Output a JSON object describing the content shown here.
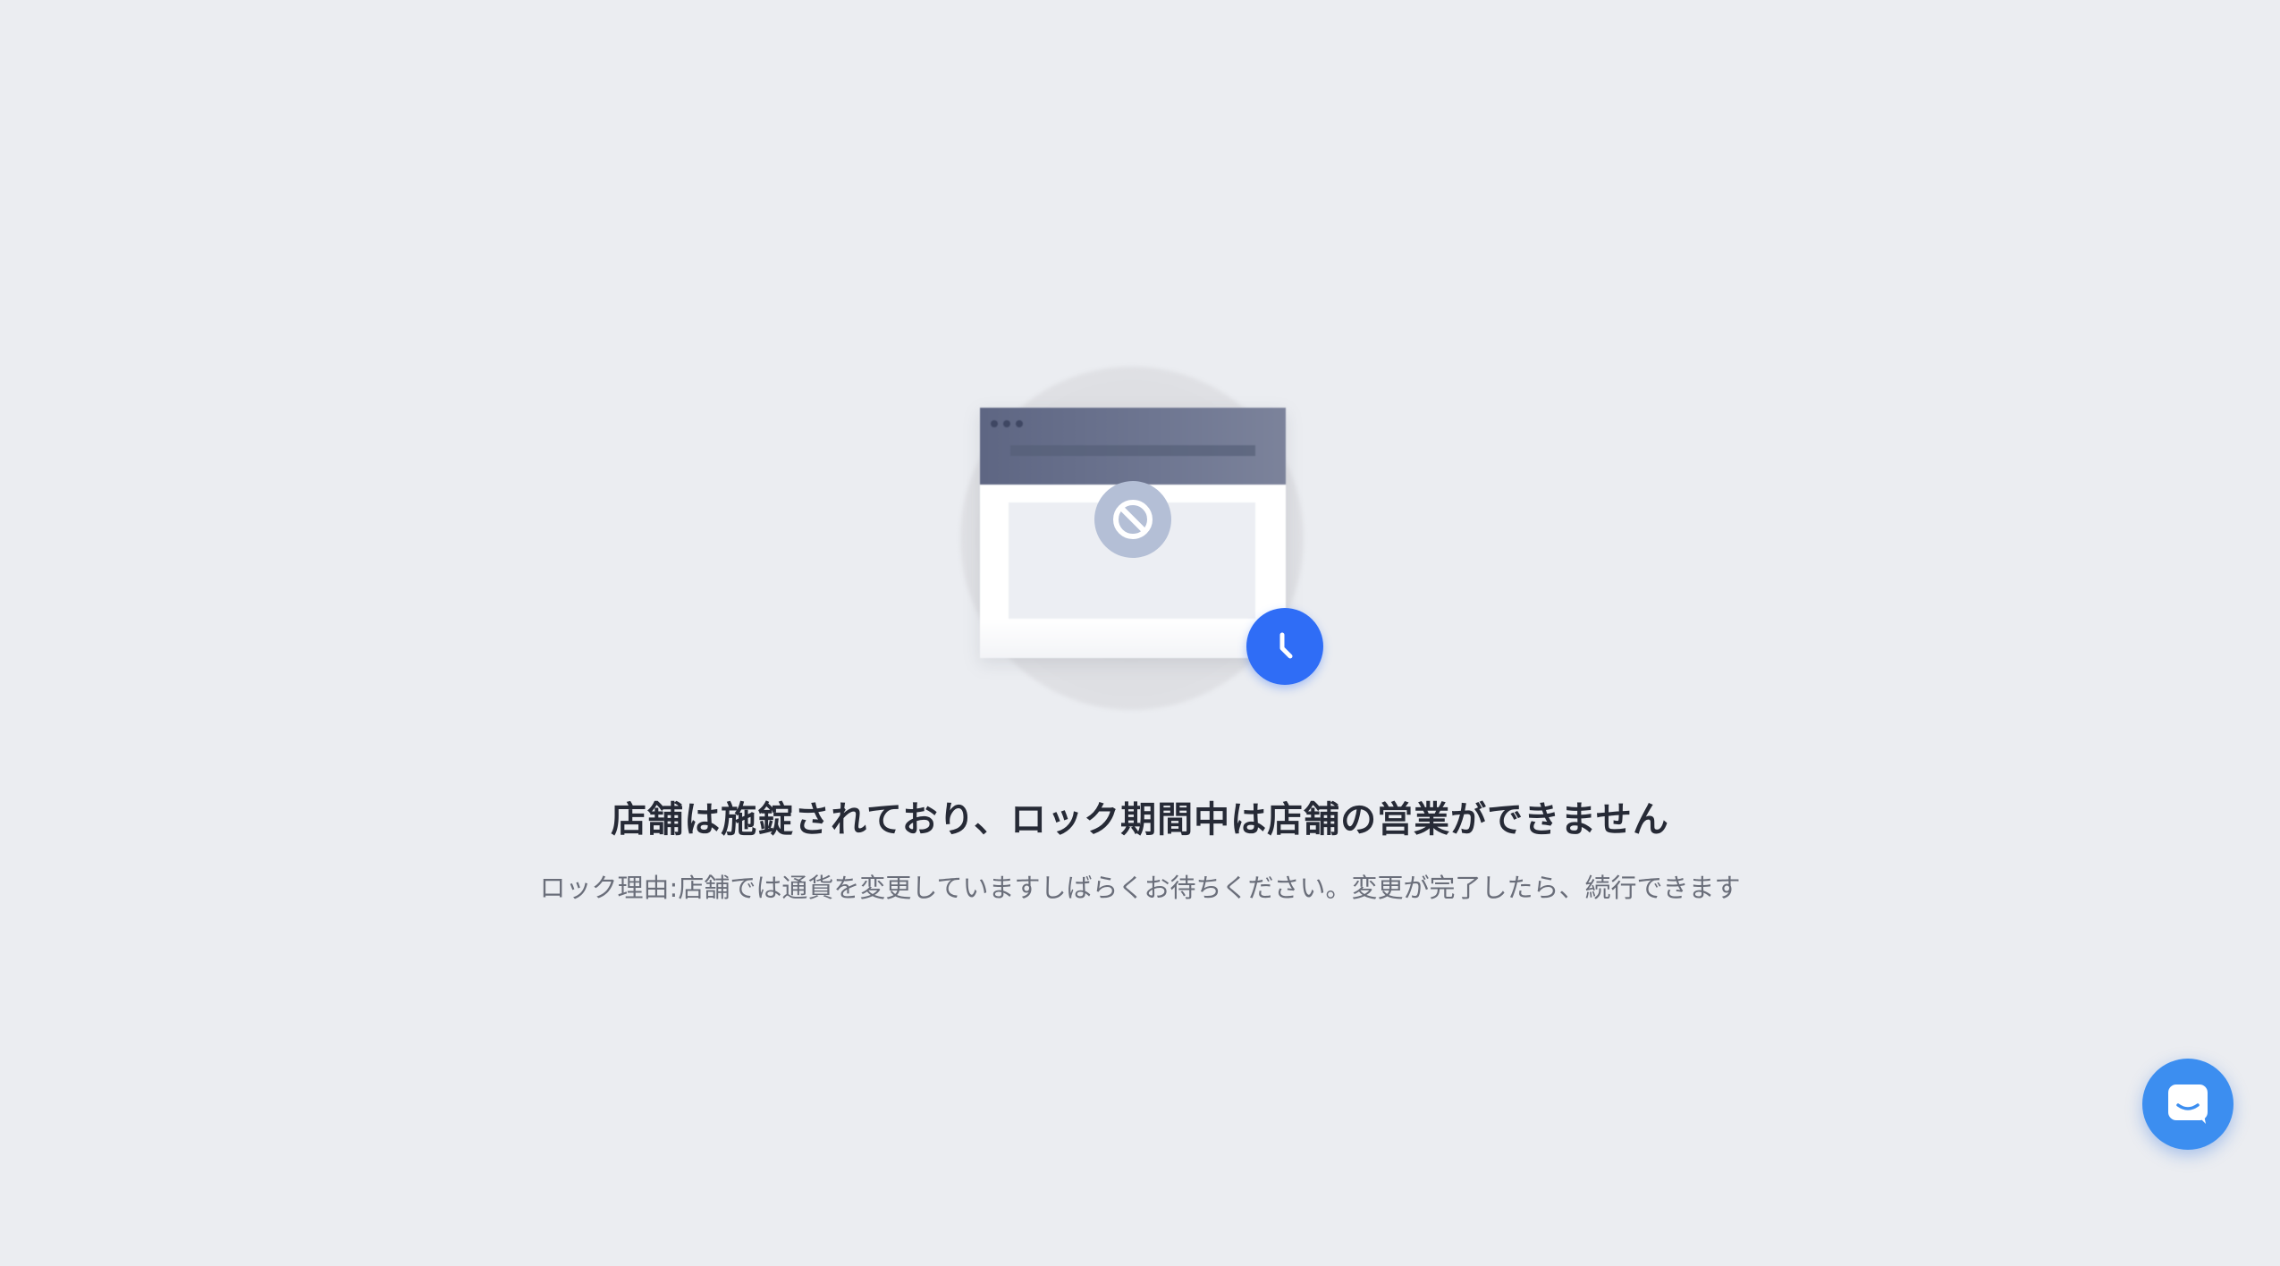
{
  "lock_page": {
    "title": "店舗は施錠されており、ロック期間中は店舗の営業ができません",
    "reason": "ロック理由:店舗では通貨を変更していますしばらくお待ちください。変更が完了したら、続行できます"
  },
  "illustration": {
    "window_icon": "browser-window-icon",
    "block_icon": "no-entry-icon",
    "clock_icon": "clock-icon"
  },
  "chat": {
    "icon": "chat-bubble-icon"
  },
  "colors": {
    "background": "#ebedf1",
    "accent_blue": "#2f6df6",
    "chat_blue": "#3c8ef0",
    "title_text": "#262a36",
    "reason_text": "#6a6e7a"
  }
}
